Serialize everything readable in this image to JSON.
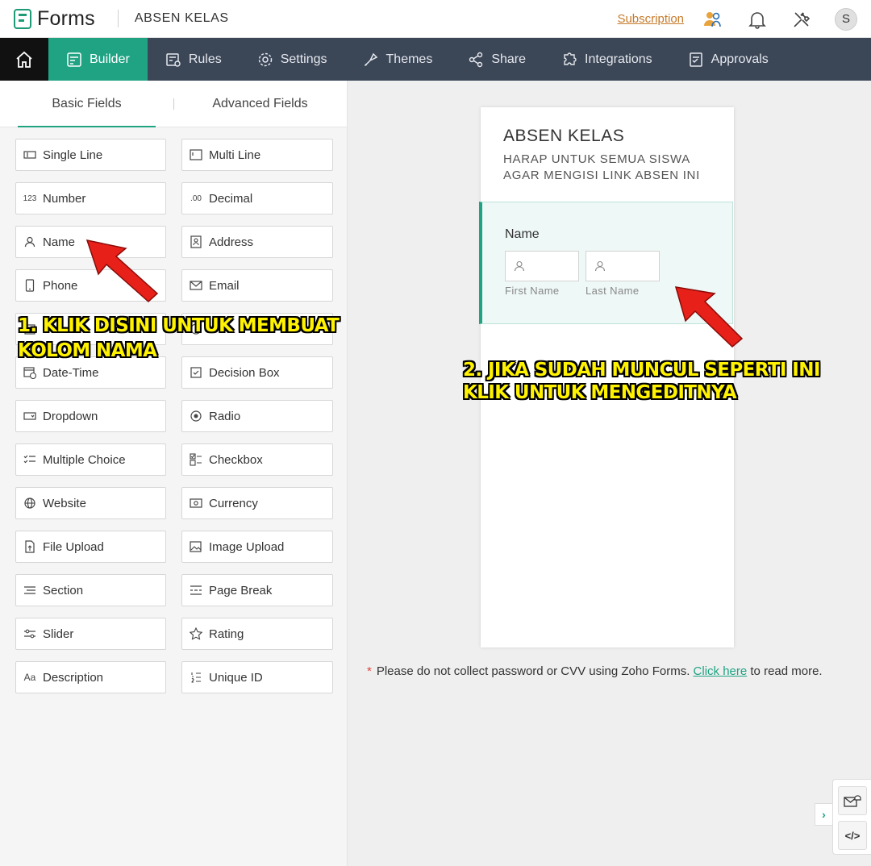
{
  "header": {
    "app_name": "Forms",
    "form_name": "ABSEN KELAS",
    "subscription": "Subscription",
    "avatar_initial": "S",
    "icons": [
      "users-icon",
      "bell-icon",
      "tools-icon"
    ]
  },
  "nav": {
    "items": [
      {
        "label": "Builder",
        "icon": "builder-icon",
        "active": true
      },
      {
        "label": "Rules",
        "icon": "rules-icon"
      },
      {
        "label": "Settings",
        "icon": "gear-icon"
      },
      {
        "label": "Themes",
        "icon": "themes-icon"
      },
      {
        "label": "Share",
        "icon": "share-icon"
      },
      {
        "label": "Integrations",
        "icon": "puzzle-icon"
      },
      {
        "label": "Approvals",
        "icon": "approvals-icon"
      }
    ]
  },
  "tabs": {
    "basic": "Basic Fields",
    "advanced": "Advanced Fields"
  },
  "fields": [
    {
      "label": "Single Line",
      "icon": "single-line-icon"
    },
    {
      "label": "Multi Line",
      "icon": "multi-line-icon"
    },
    {
      "label": "Number",
      "icon": "number-icon"
    },
    {
      "label": "Decimal",
      "icon": "decimal-icon"
    },
    {
      "label": "Name",
      "icon": "person-icon"
    },
    {
      "label": "Address",
      "icon": "address-icon"
    },
    {
      "label": "Phone",
      "icon": "phone-icon"
    },
    {
      "label": "Email",
      "icon": "email-icon"
    },
    {
      "label": "",
      "icon": "date-icon"
    },
    {
      "label": "",
      "icon": "time-icon"
    },
    {
      "label": "Date-Time",
      "icon": "date-time-icon"
    },
    {
      "label": "Decision Box",
      "icon": "decision-box-icon"
    },
    {
      "label": "Dropdown",
      "icon": "dropdown-icon"
    },
    {
      "label": "Radio",
      "icon": "radio-icon"
    },
    {
      "label": "Multiple Choice",
      "icon": "multiple-choice-icon"
    },
    {
      "label": "Checkbox",
      "icon": "checkbox-icon"
    },
    {
      "label": "Website",
      "icon": "globe-icon"
    },
    {
      "label": "Currency",
      "icon": "currency-icon"
    },
    {
      "label": "File Upload",
      "icon": "file-upload-icon"
    },
    {
      "label": "Image Upload",
      "icon": "image-upload-icon"
    },
    {
      "label": "Section",
      "icon": "section-icon"
    },
    {
      "label": "Page Break",
      "icon": "page-break-icon"
    },
    {
      "label": "Slider",
      "icon": "slider-icon"
    },
    {
      "label": "Rating",
      "icon": "star-icon"
    },
    {
      "label": "Description",
      "icon": "description-icon"
    },
    {
      "label": "Unique ID",
      "icon": "unique-id-icon"
    }
  ],
  "form": {
    "title": "ABSEN KELAS",
    "description": "HARAP UNTUK SEMUA SISWA AGAR MENGISI LINK ABSEN INI",
    "name_field": {
      "label": "Name",
      "first": "First Name",
      "last": "Last Name"
    }
  },
  "note": {
    "star": "*",
    "text": "Please do not collect password or CVV using Zoho Forms.",
    "link": "Click here",
    "suffix": "to read more."
  },
  "side_tools": {
    "embed": "</>",
    "expander": "›"
  },
  "annotations": {
    "step1_line1": "1. KLIK DISINI UNTUK MEMBUAT",
    "step1_line2": "KOLOM NAMA",
    "step2_line1": "2. JIKA SUDAH MUNCUL SEPERTI INI",
    "step2_line2": "KLIK UNTUK MENGEDITNYA",
    "color": "#fff200",
    "arrow_color": "#e8201a"
  }
}
